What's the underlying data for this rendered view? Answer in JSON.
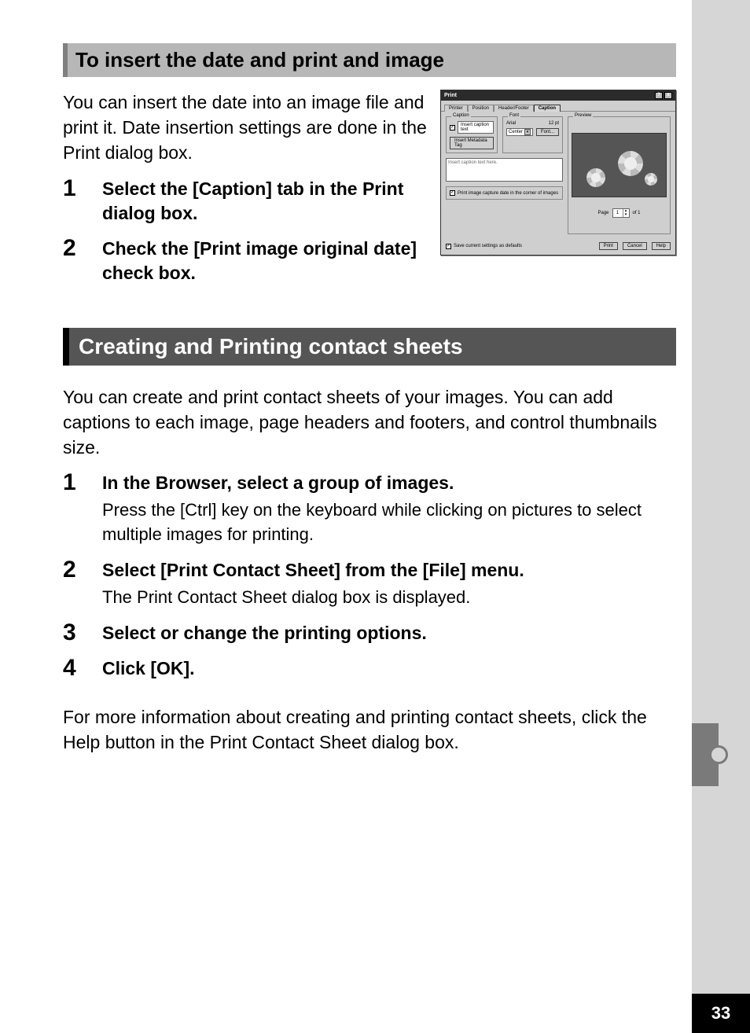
{
  "page_number": "33",
  "section1": {
    "heading": "To insert the date and print and image",
    "intro": "You can insert the date into an image file and print it. Date insertion settings are done in the Print dialog box.",
    "steps": [
      {
        "num": "1",
        "head": "Select the [Caption] tab in the Print dialog box."
      },
      {
        "num": "2",
        "head": "Check the [Print image original date] check box."
      }
    ]
  },
  "dialog": {
    "title": "Print",
    "window_buttons": {
      "help": "?",
      "close": "x"
    },
    "tabs": [
      "Printer",
      "Position",
      "Header/Footer",
      "Caption"
    ],
    "active_tab": "Caption",
    "caption_group": "Caption",
    "insert_caption_text_label": "Insert caption text",
    "insert_metadata_tag_btn": "Insert Metadata Tag",
    "caption_placeholder": "Insert caption text here.",
    "font_group": "Font",
    "font_name": "Arial",
    "font_size": "12 pt",
    "font_align_value": "Center",
    "font_button": "Font...",
    "print_date_label": "Print image capture date in the corner of images",
    "preview_label": "Preview",
    "page_label_pre": "Page",
    "page_value": "1",
    "page_label_post": "of  1",
    "save_defaults_label": "Save current settings as defaults",
    "btn_print": "Print",
    "btn_cancel": "Cancel",
    "btn_help": "Help"
  },
  "section2": {
    "heading": "Creating and Printing contact sheets",
    "intro": "You can create and print contact sheets of your images. You can add captions to each image, page headers and footers, and control thumbnails size.",
    "steps": [
      {
        "num": "1",
        "head": "In the Browser, select a group of images.",
        "desc": "Press the [Ctrl] key on the keyboard while clicking on pictures to select multiple images for printing."
      },
      {
        "num": "2",
        "head": "Select [Print Contact Sheet] from the [File] menu.",
        "desc": "The Print Contact Sheet dialog box is displayed."
      },
      {
        "num": "3",
        "head": "Select or change the printing options."
      },
      {
        "num": "4",
        "head": "Click [OK]."
      }
    ],
    "outro": "For more information about creating and printing contact sheets, click the Help button in the Print Contact Sheet dialog box."
  }
}
